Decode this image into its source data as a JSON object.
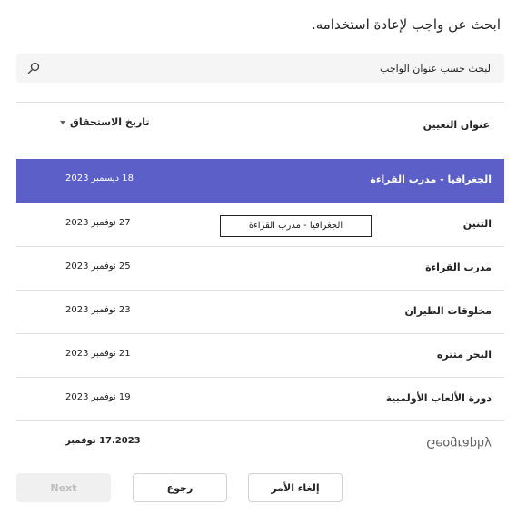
{
  "dialog": {
    "title": "ابحث عن واجب لإعادة استخدامه."
  },
  "search": {
    "placeholder": "البحث حسب عنوان الواجب"
  },
  "table": {
    "columns": {
      "title": "عنوان التعيين",
      "date": "تاريخ الاستحقاق"
    },
    "rows": [
      {
        "name": "الجغرافيا - مدرب القراءة",
        "date": "18 ديسمبر 2023"
      },
      {
        "name": "التنين",
        "date": "27 نوفمبر 2023"
      },
      {
        "name": "مدرب القراءة",
        "date": "25 نوفمبر 2023"
      },
      {
        "name": "مخلوقات الطيران",
        "date": "23 نوفمبر 2023"
      },
      {
        "name": "البحر متتره",
        "date": "21 نوفمبر 2023"
      },
      {
        "name": "دورة الألعاب الأولمبية",
        "date": "19 نوفمبر 2023"
      },
      {
        "name": "Geography",
        "date": "17.2023 نوفمبر"
      }
    ]
  },
  "tooltip": {
    "text": "الجغرافيا - مدرب القراءة"
  },
  "footer": {
    "next_label": "Next",
    "back_label": "رجوع",
    "cancel_label": "إلغاء الأمر"
  },
  "colors": {
    "accent": "#5b5fc7",
    "disabled_bg": "#f0f0f0",
    "disabled_text": "#bdbdbd"
  },
  "icons": {
    "search": "search-icon",
    "sort": "chevron-down-icon"
  }
}
